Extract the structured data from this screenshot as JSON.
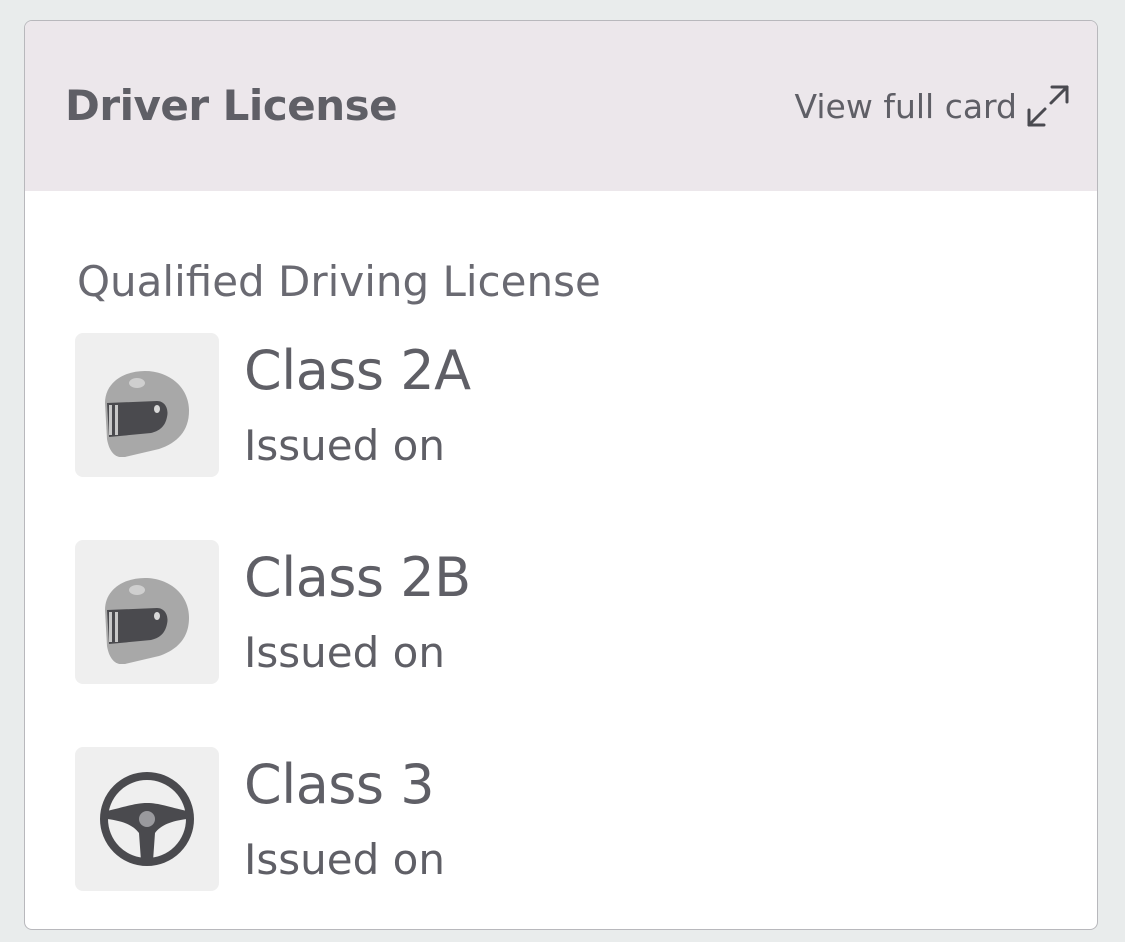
{
  "card": {
    "title": "Driver License",
    "view_full_label": "View full card",
    "section_label": "Qualified Driving License",
    "licenses": [
      {
        "class_name": "Class 2A",
        "issued_label": "Issued on",
        "icon": "motorcycle-helmet-icon"
      },
      {
        "class_name": "Class 2B",
        "issued_label": "Issued on",
        "icon": "motorcycle-helmet-icon"
      },
      {
        "class_name": "Class 3",
        "issued_label": "Issued on",
        "icon": "steering-wheel-icon"
      }
    ]
  },
  "colors": {
    "header_bg": "#ece7eb",
    "text": "#5f5f66",
    "tile_bg": "#efefef",
    "page_bg": "#e9ecec"
  }
}
